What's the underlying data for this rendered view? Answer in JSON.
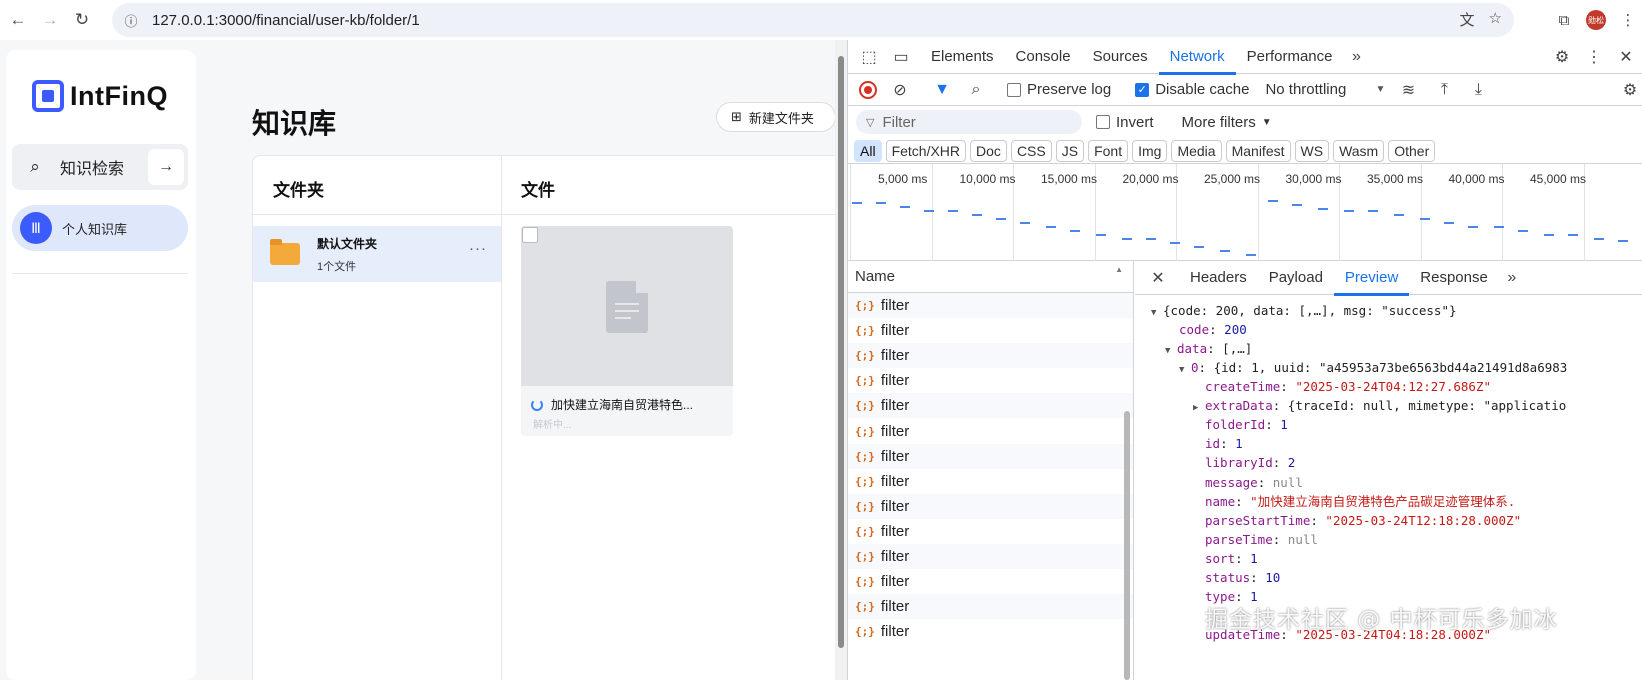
{
  "browser": {
    "url": "127.0.0.1:3000/financial/user-kb/folder/1",
    "avatar_text": "勋松"
  },
  "app": {
    "logo_text": "IntFinQ",
    "sidebar": {
      "search_label": "知识检索",
      "kb_label": "个人知识库",
      "kb_icon_glyph": "Ⅲ"
    },
    "page_title": "知识库",
    "new_folder_label": "新建文件夹",
    "folder_column_title": "文件夹",
    "file_column_title": "文件",
    "folder": {
      "name": "默认文件夹",
      "count": "1个文件"
    },
    "file": {
      "title": "加快建立海南自贸港特色...",
      "status": "解析中..."
    }
  },
  "devtools": {
    "tabs": [
      "Elements",
      "Console",
      "Sources",
      "Network",
      "Performance"
    ],
    "active_tab": "Network",
    "toolbar": {
      "preserve_log": "Preserve log",
      "disable_cache": "Disable cache",
      "throttling": "No throttling"
    },
    "filter_placeholder": "Filter",
    "invert_label": "Invert",
    "more_filters": "More filters",
    "types": [
      "All",
      "Fetch/XHR",
      "Doc",
      "CSS",
      "JS",
      "Font",
      "Img",
      "Media",
      "Manifest",
      "WS",
      "Wasm",
      "Other"
    ],
    "timeline_labels": [
      "5,000 ms",
      "10,000 ms",
      "15,000 ms",
      "20,000 ms",
      "25,000 ms",
      "30,000 ms",
      "35,000 ms",
      "40,000 ms",
      "45,000 ms"
    ],
    "name_header": "Name",
    "requests": [
      "filter",
      "filter",
      "filter",
      "filter",
      "filter",
      "filter",
      "filter",
      "filter",
      "filter",
      "filter",
      "filter",
      "filter",
      "filter",
      "filter"
    ],
    "preview_tabs": [
      "Headers",
      "Payload",
      "Preview",
      "Response"
    ],
    "active_preview_tab": "Preview",
    "preview": {
      "root": "{code: 200, data: [,…], msg: \"success\"}",
      "code_key": "code",
      "code_val": "200",
      "data_key": "data",
      "data_val": "[,…]",
      "item0_key": "0",
      "item0_val": "{id: 1, uuid: \"a45953a73be6563bd44a21491d8a6983",
      "fields": [
        {
          "key": "createTime",
          "val": "\"2025-03-24T04:12:27.686Z\"",
          "type": "str"
        },
        {
          "key": "extraData",
          "val": "{traceId: null, mimetype: \"applicatio",
          "type": "obj"
        },
        {
          "key": "folderId",
          "val": "1",
          "type": "num"
        },
        {
          "key": "id",
          "val": "1",
          "type": "num"
        },
        {
          "key": "libraryId",
          "val": "2",
          "type": "num"
        },
        {
          "key": "message",
          "val": "null",
          "type": "nul"
        },
        {
          "key": "name",
          "val": "\"加快建立海南自贸港特色产品碳足迹管理体系.",
          "type": "str"
        },
        {
          "key": "parseStartTime",
          "val": "\"2025-03-24T12:18:28.000Z\"",
          "type": "str"
        },
        {
          "key": "parseTime",
          "val": "null",
          "type": "nul"
        },
        {
          "key": "sort",
          "val": "1",
          "type": "num"
        },
        {
          "key": "status",
          "val": "10",
          "type": "num"
        },
        {
          "key": "type",
          "val": "1",
          "type": "num"
        },
        {
          "key": "",
          "val": "",
          "type": "blank"
        },
        {
          "key": "updateTime",
          "val": "\"2025-03-24T04:18:28.000Z\"",
          "type": "str"
        }
      ]
    }
  },
  "watermark": "掘金技术社区 @ 中杯可乐多加冰"
}
